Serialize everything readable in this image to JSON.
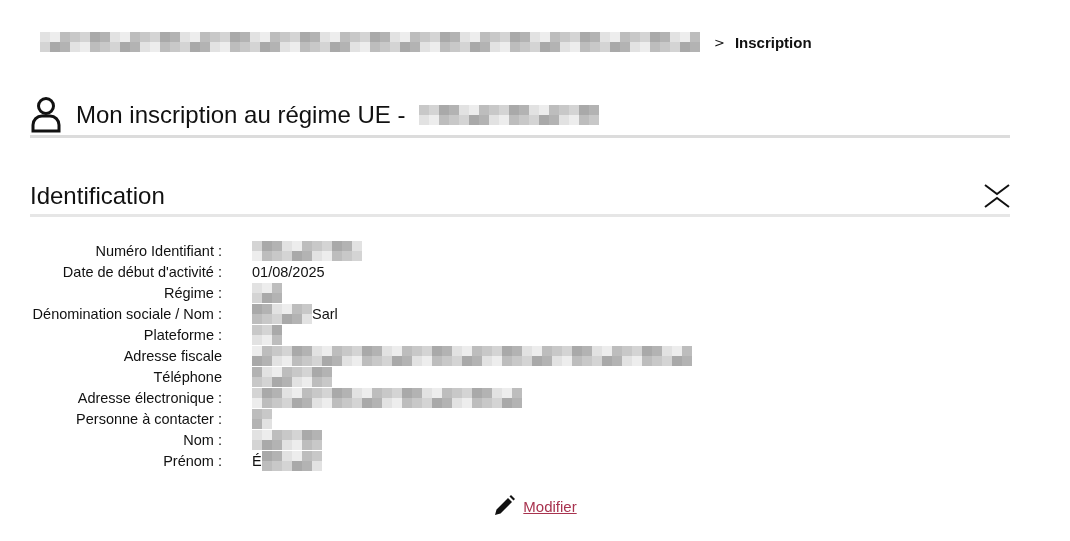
{
  "breadcrumb": {
    "separator": ">",
    "current": "Inscription"
  },
  "page_title": {
    "text": "Mon inscription au régime UE -"
  },
  "section": {
    "title": "Identification",
    "expanded": true,
    "fields": [
      {
        "label": "Numéro Identifiant :",
        "kind": "redacted"
      },
      {
        "label": "Date de début d'activité :",
        "value": "01/08/2025",
        "kind": "plain"
      },
      {
        "label": "Régime :",
        "kind": "redacted"
      },
      {
        "label": "Dénomination sociale / Nom :",
        "value": "Sarl",
        "kind": "redactedprefix"
      },
      {
        "label": "Plateforme :",
        "kind": "redacted"
      },
      {
        "label": "Adresse fiscale",
        "kind": "redacted"
      },
      {
        "label": "Téléphone",
        "kind": "redacted"
      },
      {
        "label": "Adresse électronique :",
        "kind": "redacted"
      },
      {
        "label": "Personne à contacter :",
        "kind": "redacted"
      },
      {
        "label": "Nom :",
        "kind": "redacted"
      },
      {
        "label": "Prénom :",
        "value": "É",
        "kind": "redactedsuffix"
      }
    ]
  },
  "edit_link": {
    "label": "Modifier"
  }
}
